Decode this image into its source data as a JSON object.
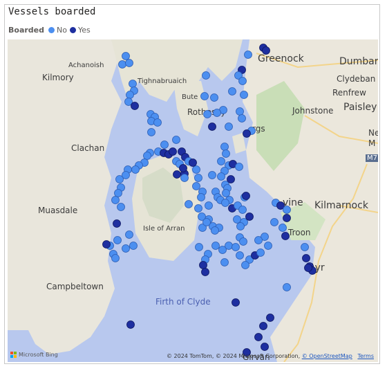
{
  "title": "Vessels boarded",
  "legend": {
    "title": "Boarded",
    "items": [
      {
        "label": "No",
        "color": "#4c8ff0"
      },
      {
        "label": "Yes",
        "color": "#1e2fa0"
      }
    ]
  },
  "map_labels": {
    "greenock": "Greenock",
    "dumbarton": "Dumbarto",
    "achanoish": "Achanoish",
    "kilmory": "Kilmory",
    "tighnabruaich": "Tighnabruaich",
    "clydebank": "Clydeban",
    "bute": "Bute",
    "renfrew": "Renfrew",
    "rothesay": "Rothesay",
    "johnstone": "Johnstone",
    "paisley": "Paisley",
    "largs": "rgs",
    "new": "New",
    "m": "M",
    "m77": "M77",
    "clachan": "Clachan",
    "irvine": "vine",
    "kilmarnock": "Kilmarnock",
    "muasdale": "Muasdale",
    "isle_of_arran": "Isle of Arran",
    "troon": "Troon",
    "ayr": "Ayr",
    "campbeltown": "Campbeltown",
    "firth_of_clyde": "Firth of Clyde",
    "girvan": "Girvan"
  },
  "attribution": {
    "brand": "Microsoft Bing",
    "text": "© 2024 TomTom, © 2024 Microsoft Corporation, ",
    "osm": "© OpenStreetMap",
    "terms": "Terms"
  }
}
